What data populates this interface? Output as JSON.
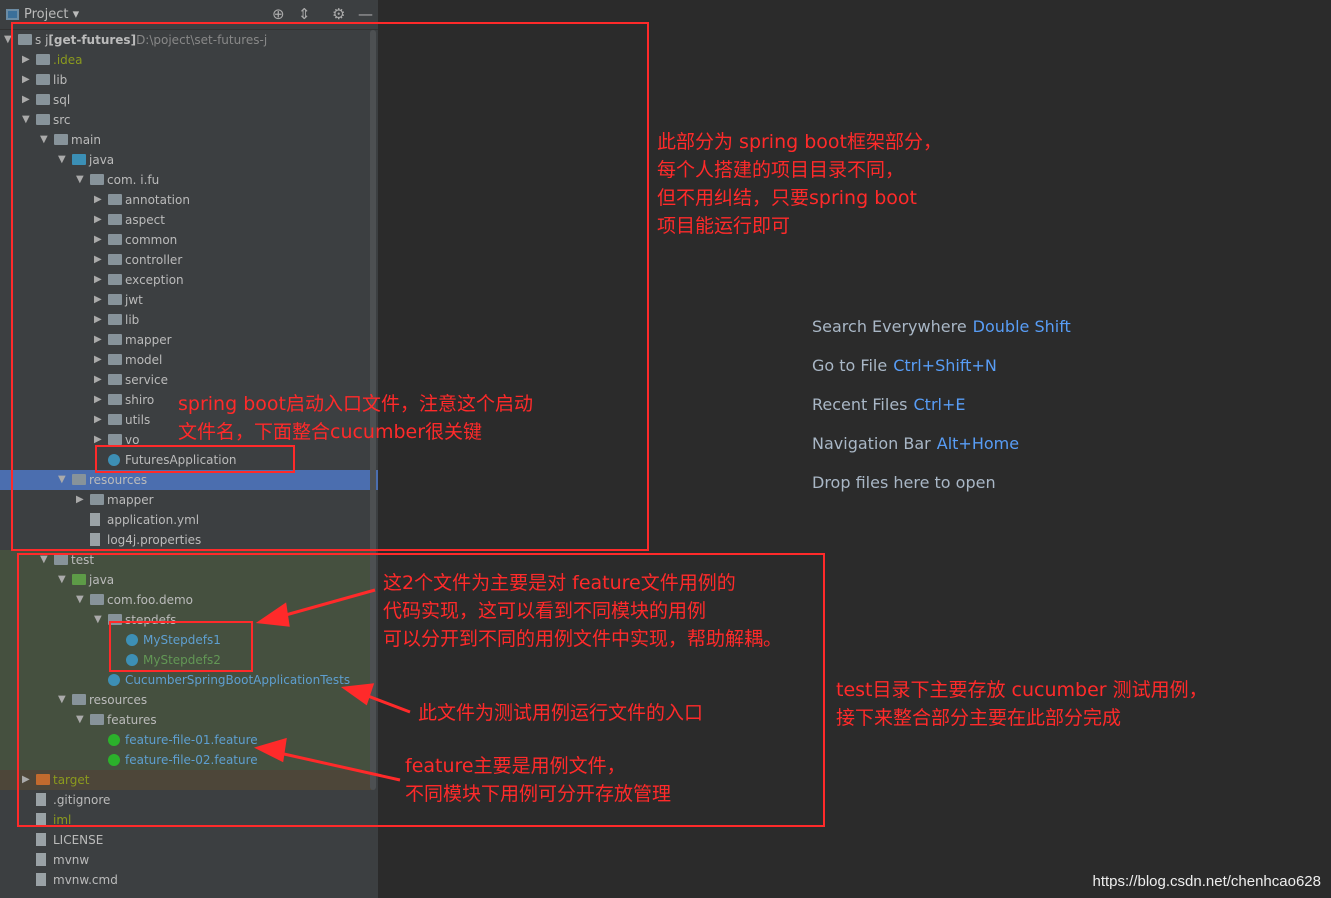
{
  "header": {
    "title": "Project",
    "icons": [
      "locate-icon",
      "collapse-icon",
      "gear-icon",
      "minimize-icon"
    ]
  },
  "tree": [
    {
      "level": 0,
      "arrow": "down",
      "icon": "module",
      "text": "s          j",
      "bold": "[get-futures]",
      "path": "D:\\poject\\set-futures-j"
    },
    {
      "level": 1,
      "arrow": "right",
      "icon": "folder",
      "text": ".idea",
      "color": "#8b9a1e"
    },
    {
      "level": 1,
      "arrow": "right",
      "icon": "folder",
      "text": "lib"
    },
    {
      "level": 1,
      "arrow": "right",
      "icon": "folder",
      "text": "sql"
    },
    {
      "level": 1,
      "arrow": "down",
      "icon": "folder",
      "text": "src"
    },
    {
      "level": 2,
      "arrow": "down",
      "icon": "folder",
      "text": "main"
    },
    {
      "level": 3,
      "arrow": "down",
      "icon": "folder-blue",
      "text": "java"
    },
    {
      "level": 4,
      "arrow": "down",
      "icon": "package",
      "text": "com.     i.fu"
    },
    {
      "level": 5,
      "arrow": "right",
      "icon": "package",
      "text": "annotation"
    },
    {
      "level": 5,
      "arrow": "right",
      "icon": "package",
      "text": "aspect"
    },
    {
      "level": 5,
      "arrow": "right",
      "icon": "package",
      "text": "common"
    },
    {
      "level": 5,
      "arrow": "right",
      "icon": "package",
      "text": "controller"
    },
    {
      "level": 5,
      "arrow": "right",
      "icon": "package",
      "text": "exception"
    },
    {
      "level": 5,
      "arrow": "right",
      "icon": "package",
      "text": "jwt"
    },
    {
      "level": 5,
      "arrow": "right",
      "icon": "package",
      "text": "lib"
    },
    {
      "level": 5,
      "arrow": "right",
      "icon": "package",
      "text": "mapper"
    },
    {
      "level": 5,
      "arrow": "right",
      "icon": "package",
      "text": "model"
    },
    {
      "level": 5,
      "arrow": "right",
      "icon": "package",
      "text": "service"
    },
    {
      "level": 5,
      "arrow": "right",
      "icon": "package",
      "text": "shiro"
    },
    {
      "level": 5,
      "arrow": "right",
      "icon": "package",
      "text": "utils"
    },
    {
      "level": 5,
      "arrow": "right",
      "icon": "package",
      "text": "vo"
    },
    {
      "level": 5,
      "arrow": "",
      "icon": "spring-class",
      "text": "FuturesApplication"
    },
    {
      "level": 3,
      "arrow": "down",
      "icon": "folder",
      "text": "resources"
    },
    {
      "level": 4,
      "arrow": "right",
      "icon": "folder",
      "text": "mapper"
    },
    {
      "level": 4,
      "arrow": "",
      "icon": "yml",
      "text": "application.yml"
    },
    {
      "level": 4,
      "arrow": "",
      "icon": "properties",
      "text": "log4j.properties"
    },
    {
      "level": 2,
      "arrow": "down",
      "icon": "folder",
      "text": "test"
    },
    {
      "level": 3,
      "arrow": "down",
      "icon": "folder-green",
      "text": "java"
    },
    {
      "level": 4,
      "arrow": "down",
      "icon": "package",
      "text": "com.foo.demo"
    },
    {
      "level": 5,
      "arrow": "down",
      "icon": "package",
      "text": "stepdefs"
    },
    {
      "level": 6,
      "arrow": "",
      "icon": "class",
      "text": "MyStepdefs1",
      "color": "#5e9fd0"
    },
    {
      "level": 6,
      "arrow": "",
      "icon": "class",
      "text": "MyStepdefs2",
      "color": "#629755"
    },
    {
      "level": 5,
      "arrow": "",
      "icon": "class",
      "text": "CucumberSpringBootApplicationTests",
      "color": "#5e9fd0"
    },
    {
      "level": 3,
      "arrow": "down",
      "icon": "folder",
      "text": "resources"
    },
    {
      "level": 4,
      "arrow": "down",
      "icon": "folder",
      "text": "features"
    },
    {
      "level": 5,
      "arrow": "",
      "icon": "feature",
      "text": "feature-file-01.feature",
      "color": "#5e9fd0"
    },
    {
      "level": 5,
      "arrow": "",
      "icon": "feature",
      "text": "feature-file-02.feature",
      "color": "#5e9fd0"
    },
    {
      "level": 1,
      "arrow": "right",
      "icon": "folder-orange",
      "text": "target",
      "color": "#8b9a1e"
    },
    {
      "level": 1,
      "arrow": "",
      "icon": "file",
      "text": ".gitignore"
    },
    {
      "level": 1,
      "arrow": "",
      "icon": "file",
      "text": "           iml",
      "color": "#8b9a1e"
    },
    {
      "level": 1,
      "arrow": "",
      "icon": "file",
      "text": "LICENSE"
    },
    {
      "level": 1,
      "arrow": "",
      "icon": "file",
      "text": "mvnw"
    },
    {
      "level": 1,
      "arrow": "",
      "icon": "file",
      "text": "mvnw.cmd"
    }
  ],
  "hints": [
    {
      "label": "Search Everywhere",
      "key": "Double Shift"
    },
    {
      "label": "Go to File",
      "key": "Ctrl+Shift+N"
    },
    {
      "label": "Recent Files",
      "key": "Ctrl+E"
    },
    {
      "label": "Navigation Bar",
      "key": "Alt+Home"
    },
    {
      "label": "Drop files here to open",
      "key": ""
    }
  ],
  "notes": {
    "springboot": "此部分为 spring boot框架部分，\n每个人搭建的项目目录不同，\n但不用纠结，只要spring boot\n项目能运行即可",
    "entry": "spring boot启动入口文件，注意这个启动\n文件名，下面整合cucumber很关键",
    "stepdefs": "这2个文件为主要是对 feature文件用例的\n代码实现，这可以看到不同模块的用例\n可以分开到不同的用例文件中实现，帮助解耦。",
    "tests": "此文件为测试用例运行文件的入口",
    "features": "feature主要是用例文件，\n不同模块下用例可分开存放管理",
    "testdir": "test目录下主要存放 cucumber 测试用例，\n接下来整合部分主要在此部分完成"
  },
  "watermark": "https://blog.csdn.net/chenhcao628",
  "colors": {
    "annotation": "#ff2a2a",
    "accent": "#589df6",
    "selection": "#4b6eaf"
  }
}
